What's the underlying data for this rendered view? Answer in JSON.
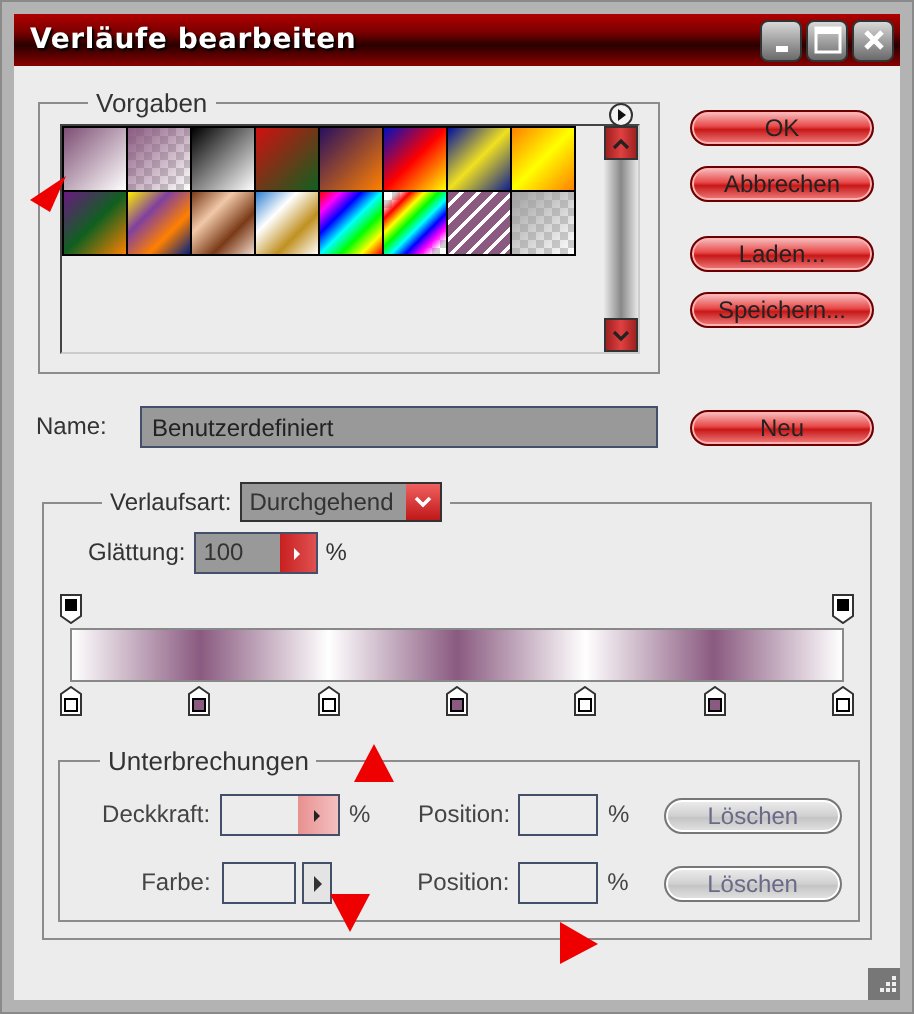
{
  "window": {
    "title": "Verläufe bearbeiten"
  },
  "presets": {
    "title": "Vorgaben"
  },
  "buttons": [
    {
      "label": "OK"
    },
    {
      "label": "Abbrechen"
    },
    {
      "label": "Laden..."
    },
    {
      "label": "Speichern..."
    }
  ],
  "name": {
    "label": "Name:",
    "value": "Benutzerdefiniert"
  },
  "new_button": {
    "label": "Neu"
  },
  "gradient": {
    "type_label": "Verlaufsart:",
    "type_value": "Durchgehend",
    "smoothness_label": "Glättung:",
    "smoothness_value": "100",
    "smoothness_unit": "%",
    "opacity_stops": [
      {
        "color": "#000000"
      },
      {
        "color": "#000000"
      }
    ],
    "color_stops": [
      {
        "color": "#ffffff"
      },
      {
        "color": "#8a5a80"
      },
      {
        "color": "#ffffff"
      },
      {
        "color": "#8a5a80"
      },
      {
        "color": "#ffffff"
      },
      {
        "color": "#8a5a80"
      },
      {
        "color": "#ffffff"
      }
    ]
  },
  "stops": {
    "title": "Unterbrechungen",
    "rows": [
      {
        "kind": "opacity",
        "label": "Deckkraft:",
        "unit": "%",
        "position_label": "Position:",
        "position_unit": "%",
        "delete_label": "Löschen",
        "disabled": true
      },
      {
        "kind": "color",
        "label": "Farbe:",
        "position_label": "Position:",
        "position_unit": "%",
        "delete_label": "Löschen",
        "disabled": true
      }
    ]
  }
}
